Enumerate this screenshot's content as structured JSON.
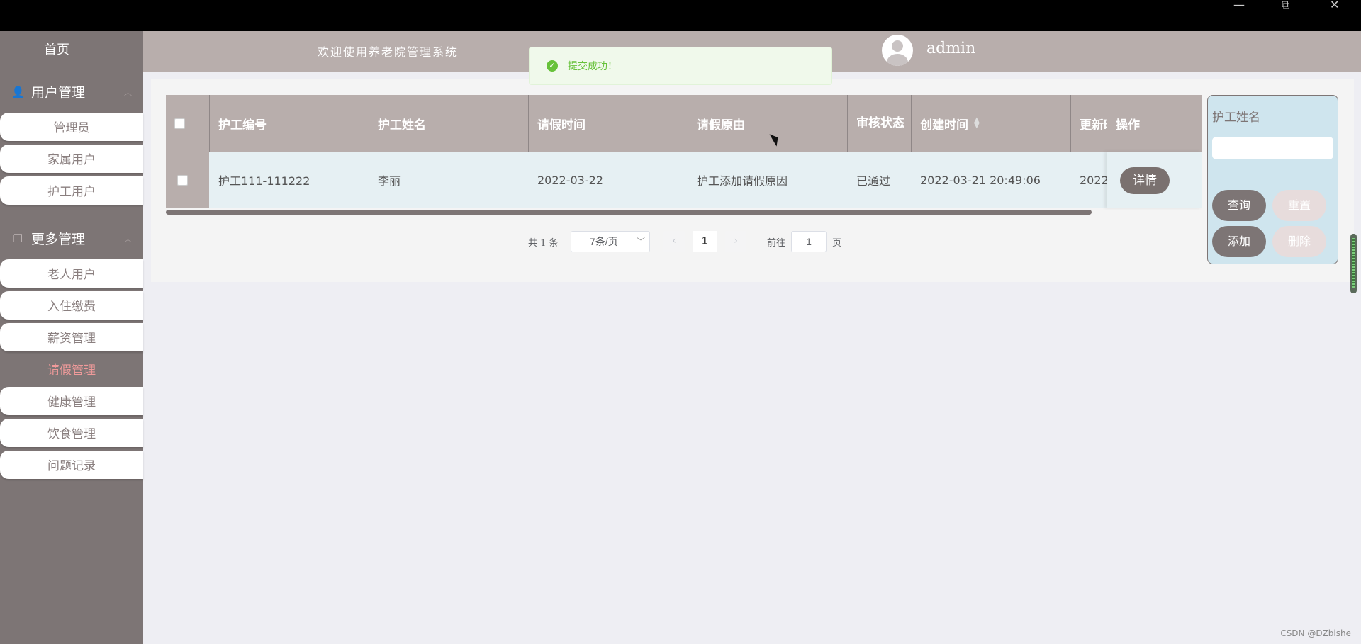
{
  "window": {
    "minimize": "—",
    "restore": "⧉",
    "close": "✕"
  },
  "sidebar": {
    "home": "首页",
    "groups": [
      {
        "title": "用户管理",
        "items": [
          "管理员",
          "家属用户",
          "护工用户"
        ]
      },
      {
        "title": "更多管理",
        "items": [
          "老人用户",
          "入住缴费",
          "薪资管理",
          "请假管理",
          "健康管理",
          "饮食管理",
          "问题记录"
        ]
      }
    ],
    "active_item": "请假管理"
  },
  "header": {
    "welcome": "欢迎使用养老院管理系统",
    "username": "admin"
  },
  "toast": {
    "message": "提交成功！"
  },
  "table": {
    "columns": [
      "护工编号",
      "护工姓名",
      "请假时间",
      "请假原由",
      "审核状态",
      "创建时间",
      "更新时间",
      "操作"
    ],
    "rows": [
      {
        "id": "护工111-111222",
        "name": "李丽",
        "leave_date": "2022-03-22",
        "reason": "护工添加请假原因",
        "status": "已通过",
        "created": "2022-03-21 20:49:06",
        "updated": "2022",
        "action": "详情"
      }
    ]
  },
  "pagination": {
    "total": "共 1 条",
    "page_size": "7条/页",
    "current_page": "1",
    "goto_label": "前往",
    "goto_value": "1",
    "page_suffix": "页"
  },
  "search": {
    "field_label": "护工姓名",
    "field_value": "",
    "buttons": {
      "query": "查询",
      "reset": "重置",
      "add": "添加",
      "delete": "删除"
    }
  },
  "watermark": "CSDN @DZbishe",
  "colors": {
    "sidebar": "#7d7575",
    "header": "#b8aeac",
    "active_menu": "#ef9a9a",
    "success": "#67c23a",
    "search_panel": "#cfe5ee"
  }
}
